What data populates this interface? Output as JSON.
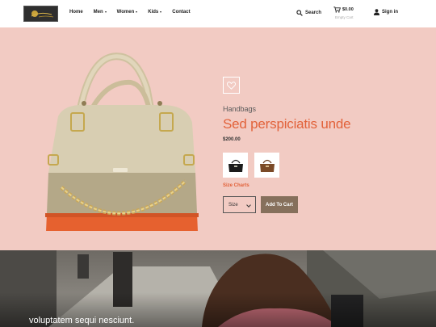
{
  "header": {
    "nav": [
      {
        "label": "Home"
      },
      {
        "label": "Men"
      },
      {
        "label": "Women"
      },
      {
        "label": "Kids"
      },
      {
        "label": "Contact"
      }
    ],
    "search_label": "Search",
    "cart_amount": "$0.00",
    "cart_sub": "Empty Cart",
    "signin_label": "Sign in"
  },
  "product": {
    "category": "Handbags",
    "title": "Sed perspiciatis unde",
    "price": "$200.00",
    "size_chart": "Size Charts",
    "size_value": "Size",
    "add_to_cart": "Add To Cart"
  },
  "hero": {
    "caption": "voluptatem sequi nesciunt."
  },
  "colors": {
    "accent": "#e2623a",
    "product_bg": "#f2cbc3",
    "button": "#86705c"
  }
}
